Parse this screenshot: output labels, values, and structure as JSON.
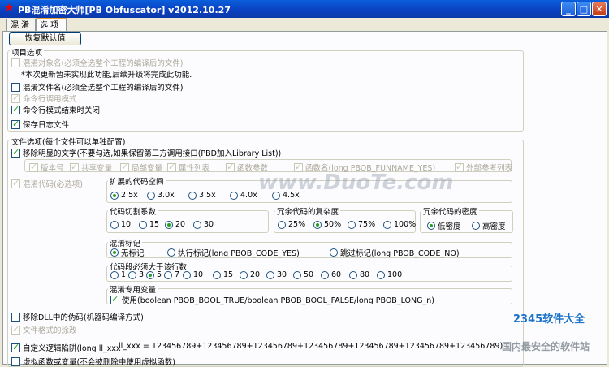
{
  "window": {
    "title": "PB混淆加密大师[PB Obfuscator] v2012.10.27",
    "min": "_",
    "max": "□",
    "close": "✕"
  },
  "tabs": [
    "混 淆",
    "选 项"
  ],
  "restore_button": "恢复默认值",
  "project_options": {
    "label": "项目选项",
    "obfuscate_objects": "混淆对象名(必须全选整个工程的编译后的文件)",
    "note": "*本次更新暂未实现此功能,后续升级将完成此功能.",
    "obfuscate_files": "混淆文件名(必须全选整个工程的编译后的文件)",
    "cmd_mode": "命令行调用模式",
    "cmd_close": "命令行模式结束时关闭",
    "save_log": "保存日志文件"
  },
  "file_options": {
    "label": "文件选项(每个文件可以单独配置)",
    "remove_plain": "移除明显的文字(不要勾选,如果保留第三方调用接口(PBD加入Library List))",
    "sub_items": [
      "版本号",
      "共享变量",
      "局部变量",
      "属性列表",
      "函数参数",
      "函数名(long PBOB_FUNNAME_YES)",
      "外部参考列表"
    ],
    "obfuscate_code": "混淆代码(必选项)",
    "remove_dll_pseudo": "移除DLL中的伪码(机器码编译方式)",
    "file_format": "文件格式的涂改",
    "custom_trap": "自定义逻辑陷阱(long ll_xxx",
    "custom_trap_expr": "ll_xxx = 123456789+123456789+123456789+123456789+123456789+123456789+123456789)",
    "last_row": "虚拟函数或变量(不会被删除中使用虚拟函数)"
  },
  "expand": {
    "label": "扩展的代码空间",
    "options": [
      "2.5x",
      "3.0x",
      "3.5x",
      "4.0x",
      "4.5x"
    ],
    "selected": "2.5x"
  },
  "cut": {
    "label": "代码切割系数",
    "options": [
      "10",
      "15",
      "20",
      "30"
    ],
    "selected": "20"
  },
  "complexity": {
    "label": "冗余代码的复杂度",
    "options": [
      "25%",
      "50%",
      "75%",
      "100%"
    ],
    "selected": "50%"
  },
  "density": {
    "label": "冗余代码的密度",
    "options": [
      "低密度",
      "高密度"
    ],
    "selected": "低密度"
  },
  "mark": {
    "label": "混淆标记",
    "options": [
      "无标记",
      "执行标记(long PBOB_CODE_YES)",
      "跳过标记(long PBOB_CODE_NO)"
    ],
    "selected": "无标记"
  },
  "min_lines": {
    "label": "代码段必须大于该行数",
    "options": [
      "1",
      "3",
      "5",
      "7",
      "10",
      "15",
      "20",
      "30",
      "50",
      "60",
      "80",
      "100"
    ],
    "selected": "5"
  },
  "special_var": {
    "label": "混淆专用变量",
    "use": "使用(boolean PBOB_BOOL_TRUE/boolean PBOB_BOOL_FALSE/long PBOB_LONG_n)"
  },
  "watermark": {
    "duote": "www.DuoTe.com",
    "brand": "2345软件大全",
    "slogan": "国内最安全的软件站"
  }
}
